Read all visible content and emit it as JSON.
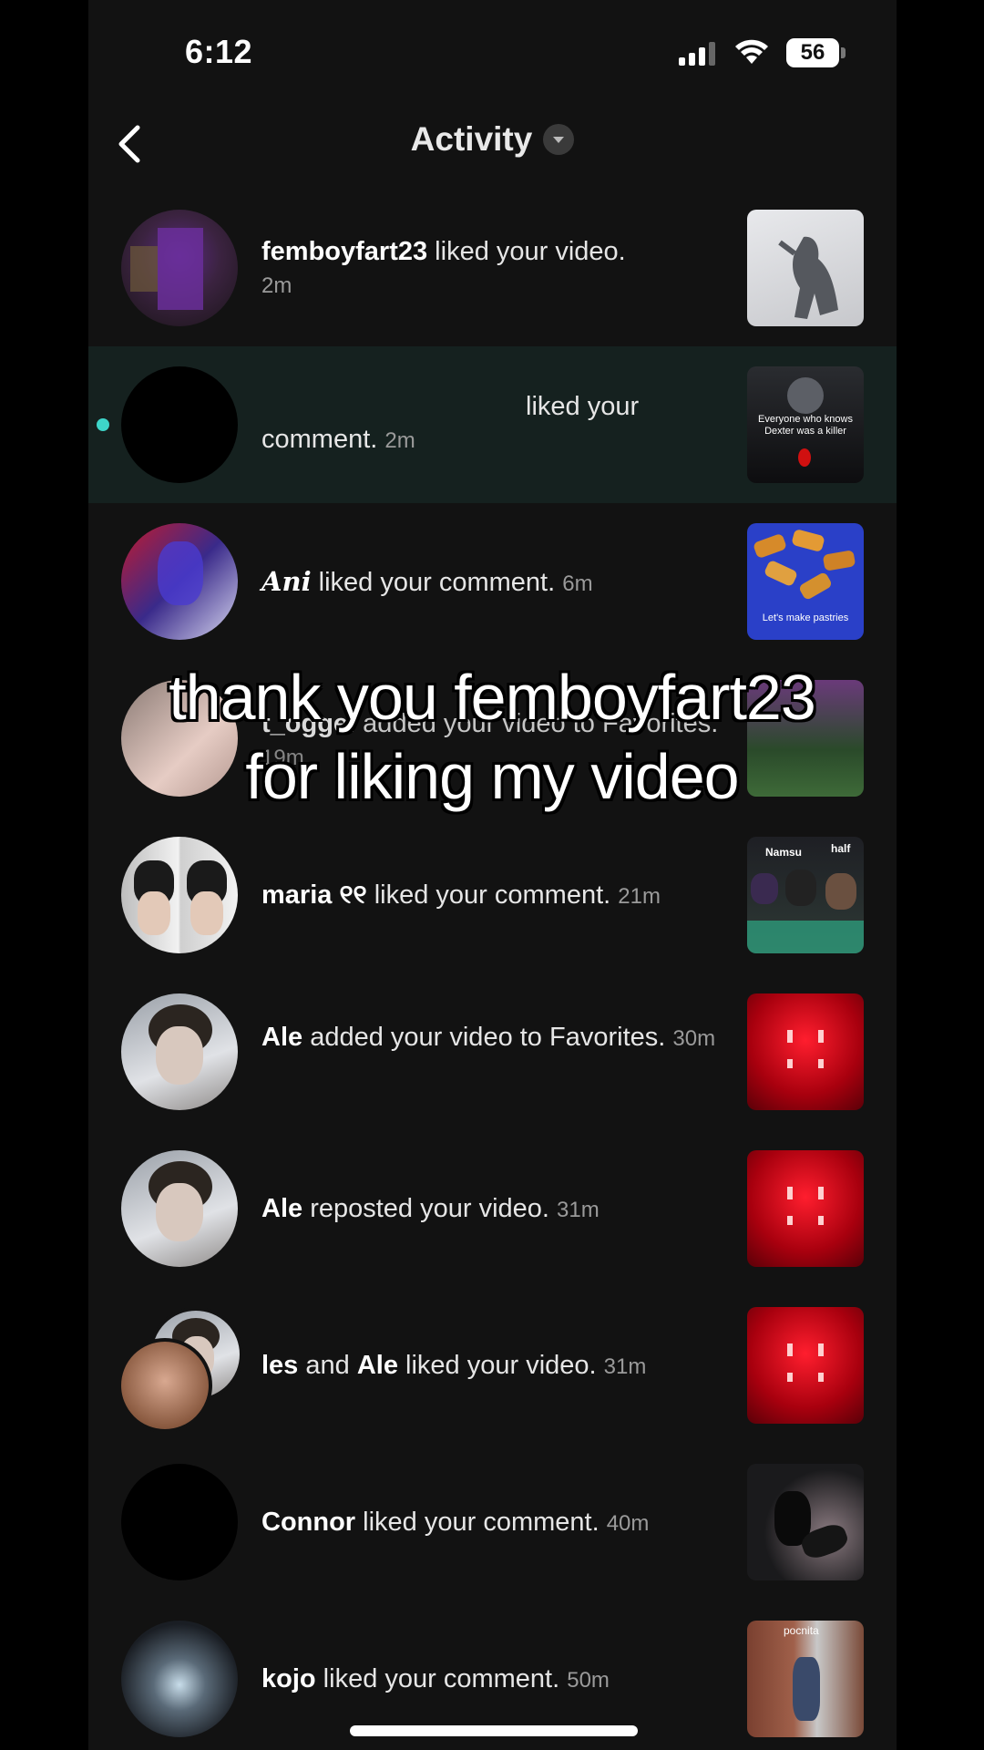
{
  "status_bar": {
    "time": "6:12",
    "battery": "56"
  },
  "header": {
    "title": "Activity"
  },
  "activity": [
    {
      "user": "femboyfart23",
      "action": " liked your video.",
      "time": "2m"
    },
    {
      "user": "",
      "action": "liked your comment.",
      "time": "2m",
      "unread": true
    },
    {
      "user": "𝑨𝒏𝒊",
      "action": " liked your comment.",
      "time": "6m"
    },
    {
      "user": "t_oggel",
      "action": " added your video to Favorites.",
      "time": "19m"
    },
    {
      "user": "maria ୧୧",
      "action": " liked your comment.",
      "time": "21m"
    },
    {
      "user": "Ale",
      "action": " added your video to Favorites.",
      "time": "30m"
    },
    {
      "user": "Ale",
      "action": " reposted your video.",
      "time": "31m"
    },
    {
      "user": "les",
      "joiner": " and ",
      "user2": "Ale",
      "action": " liked your video.",
      "time": "31m"
    },
    {
      "user": "Connor",
      "action": " liked your comment.",
      "time": "40m"
    },
    {
      "user": "kojo",
      "action": " liked your comment.",
      "time": "50m"
    }
  ],
  "thumb_text": {
    "dexter": "Everyone who knows Dexter was a killer",
    "pastries": "Let's make pastries",
    "namsu": "Namsu",
    "half": "half",
    "pocnita": "pocnita"
  },
  "overlay_caption": {
    "line1": "thank you femboyfart23",
    "line2": "for liking my video"
  },
  "colors": {
    "background": "#121212",
    "highlight_row": "#15211f",
    "unread_dot": "#3ed5c9"
  }
}
